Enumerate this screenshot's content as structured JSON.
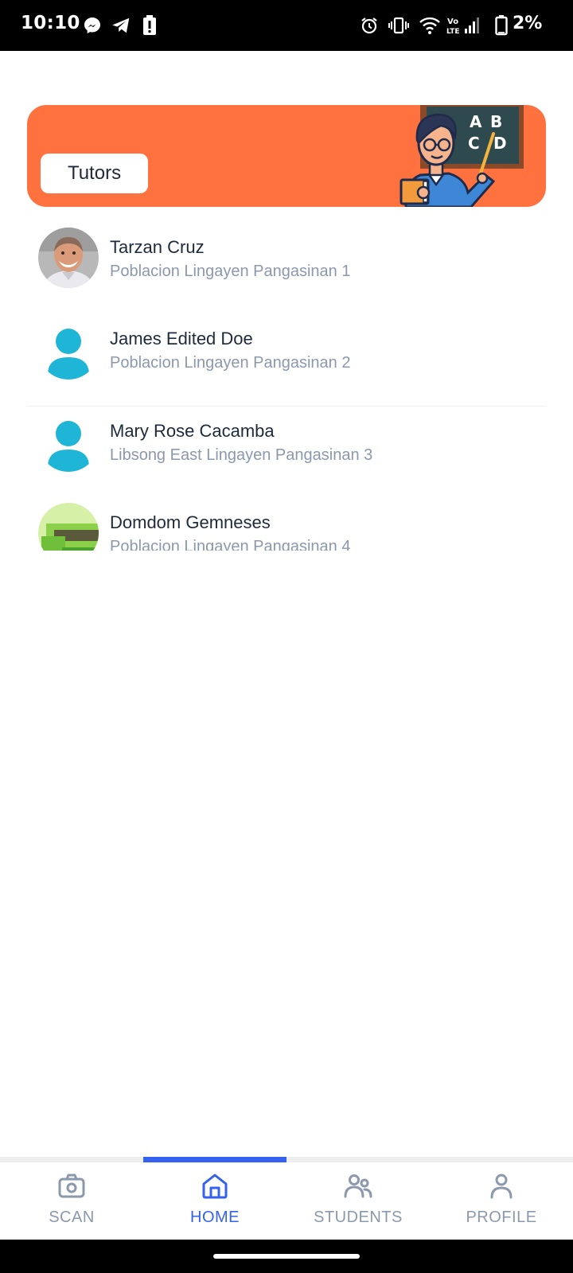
{
  "status_bar": {
    "time": "10:10",
    "battery_percent": "2%",
    "left_icons": [
      "messenger-icon",
      "telegram-icon",
      "alert-icon"
    ],
    "right_icons": [
      "alarm-icon",
      "vibrate-icon",
      "wifi-icon",
      "volte-icon",
      "signal-icon",
      "battery-icon"
    ],
    "volte_text": "Vo LTE"
  },
  "banner": {
    "button_label": "Tutors",
    "background_color": "#ff7240",
    "illustration_letters": [
      "A",
      "B",
      "C",
      "D"
    ]
  },
  "tutors": [
    {
      "name": "Tarzan Cruz",
      "address": "Poblacion Lingayen Pangasinan 1",
      "avatar": "photo"
    },
    {
      "name": "James Edited Doe",
      "address": "Poblacion Lingayen Pangasinan 2",
      "avatar": "default-person-icon"
    },
    {
      "name": "Mary Rose Cacamba",
      "address": "Libsong East Lingayen Pangasinan 3",
      "avatar": "default-person-icon"
    },
    {
      "name": "Domdom Gemneses",
      "address": "Poblacion Lingayen Pangasinan 4",
      "avatar": "photo"
    }
  ],
  "bottom_nav": {
    "items": [
      {
        "label": "SCAN",
        "icon": "camera-icon"
      },
      {
        "label": "HOME",
        "icon": "home-icon",
        "active": true
      },
      {
        "label": "STUDENTS",
        "icon": "students-icon"
      },
      {
        "label": "PROFILE",
        "icon": "profile-icon"
      }
    ],
    "active_color": "#3461ee",
    "inactive_color": "#8c98ad"
  }
}
